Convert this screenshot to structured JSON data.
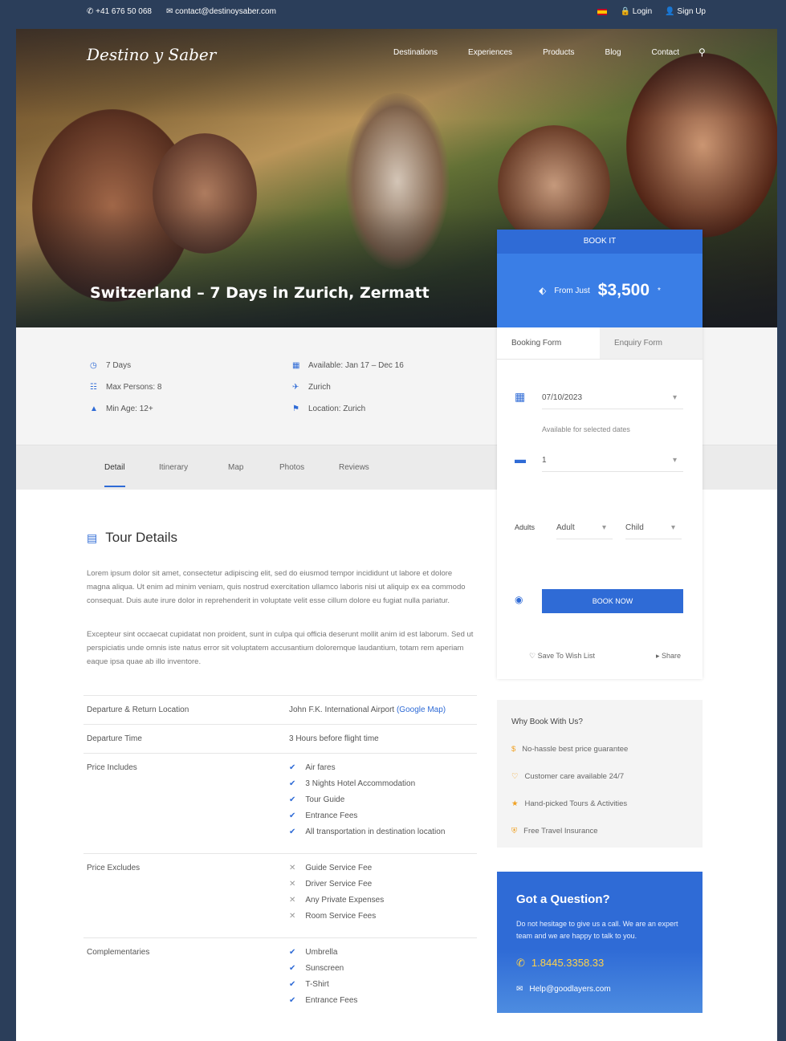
{
  "topbar": {
    "phone": "+41 676 50 068",
    "email": "contact@destinoysaber.com",
    "login": "Login",
    "signup": "Sign Up"
  },
  "header": {
    "logo": "Destino y Saber",
    "nav": [
      "Destinations",
      "Experiences",
      "Products",
      "Blog",
      "Contact"
    ]
  },
  "hero": {
    "title": "Switzerland – 7 Days in Zurich, Zermatt"
  },
  "meta": {
    "left": [
      "7 Days",
      "Max Persons: 8",
      "Min Age: 12+"
    ],
    "right": [
      "Available: Jan 17 – Dec 16",
      "Zurich",
      "Location: Zurich"
    ]
  },
  "tabs": [
    "Detail",
    "Itinerary",
    "Map",
    "Photos",
    "Reviews"
  ],
  "details": {
    "title": "Tour Details",
    "para1": "Lorem ipsum dolor sit amet, consectetur adipiscing elit, sed do eiusmod tempor incididunt ut labore et dolore magna aliqua. Ut enim ad minim veniam, quis nostrud exercitation ullamco laboris nisi ut aliquip ex ea commodo consequat. Duis aute irure dolor in reprehenderit in voluptate velit esse cillum dolore eu fugiat nulla pariatur.",
    "para2": "Excepteur sint occaecat cupidatat non proident, sunt in culpa qui officia deserunt mollit anim id est laborum. Sed ut perspiciatis unde omnis iste natus error sit voluptatem accusantium doloremque laudantium, totam rem aperiam eaque ipsa quae ab illo inventore.",
    "rows": {
      "departure_label": "Departure & Return Location",
      "departure_value": "John F.K. International Airport",
      "departure_link": "(Google Map)",
      "time_label": "Departure Time",
      "time_value": "3 Hours before flight time",
      "included_label": "Price Includes",
      "included": [
        "Air fares",
        "3 Nights Hotel Accommodation",
        "Tour Guide",
        "Entrance Fees",
        "All transportation in destination location"
      ],
      "excluded_label": "Price Excludes",
      "excluded": [
        "Guide Service Fee",
        "Driver Service Fee",
        "Any Private Expenses",
        "Room Service Fees"
      ],
      "complementary_label": "Complementaries",
      "complementary": [
        "Umbrella",
        "Sunscreen",
        "T-Shirt",
        "Entrance Fees"
      ]
    }
  },
  "booking": {
    "head": "BOOK IT",
    "from": "From Just",
    "price": "$3,500",
    "price_note": "*",
    "tab_booking": "Booking Form",
    "tab_enquiry": "Enquiry Form",
    "date": "07/10/2023",
    "date_help": "Available for selected dates",
    "guests": "1",
    "adults_label": "Adults",
    "adult_select": "Adult",
    "child_select": "Child",
    "book_button": "BOOK NOW",
    "save": "Save To Wish List",
    "share": "Share"
  },
  "why": {
    "title": "Why Book With Us?",
    "items": [
      "No-hassle best price guarantee",
      "Customer care available 24/7",
      "Hand-picked Tours & Activities",
      "Free Travel Insurance"
    ]
  },
  "question": {
    "title": "Got a Question?",
    "text": "Do not hesitage to give us a call. We are an expert team and we are happy to talk to you.",
    "phone": "1.8445.3358.33",
    "email": "Help@goodlayers.com"
  }
}
